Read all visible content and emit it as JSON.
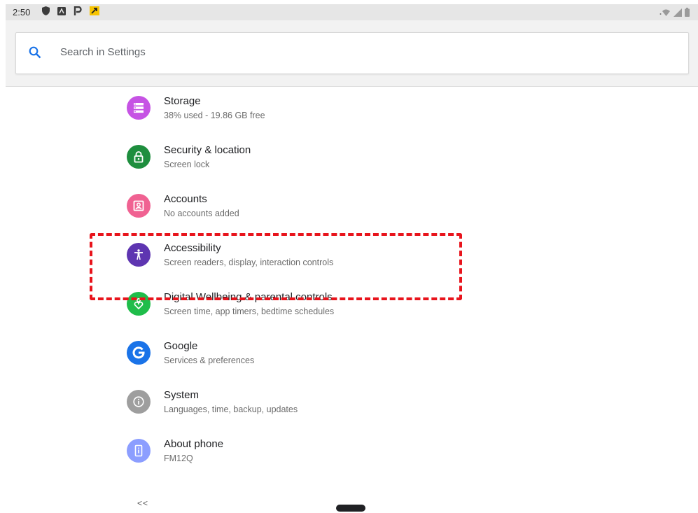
{
  "status_bar": {
    "time": "2:50",
    "left_icons": [
      "shield-icon",
      "app-a-icon",
      "p-icon",
      "notification-icon"
    ],
    "right_icons": [
      "wifi-icon",
      "signal-icon",
      "battery-icon"
    ]
  },
  "search": {
    "placeholder": "Search in Settings"
  },
  "settings_items": [
    {
      "title": "Storage",
      "summary": "38% used - 19.86 GB free",
      "icon": "storage-icon",
      "color": "#c653e4"
    },
    {
      "title": "Security & location",
      "summary": "Screen lock",
      "icon": "lock-icon",
      "color": "#1e8e3e"
    },
    {
      "title": "Accounts",
      "summary": "No accounts added",
      "icon": "account-icon",
      "color": "#f06292"
    },
    {
      "title": "Accessibility",
      "summary": "Screen readers, display, interaction controls",
      "icon": "accessibility-icon",
      "color": "#5e35b1"
    },
    {
      "title": "Digital Wellbeing & parental controls",
      "summary": "Screen time, app timers, bedtime schedules",
      "icon": "wellbeing-icon",
      "color": "#1fbd4a"
    },
    {
      "title": "Google",
      "summary": "Services & preferences",
      "icon": "google-icon",
      "color": "#1a73e8"
    },
    {
      "title": "System",
      "summary": "Languages, time, backup, updates",
      "icon": "info-icon",
      "color": "#9e9e9e"
    },
    {
      "title": "About phone",
      "summary": "FM12Q",
      "icon": "phone-info-icon",
      "color": "#8c9eff"
    }
  ],
  "highlight": {
    "target": "Accessibility",
    "color": "#e8141c"
  },
  "nav": {
    "back_label": "<<"
  }
}
